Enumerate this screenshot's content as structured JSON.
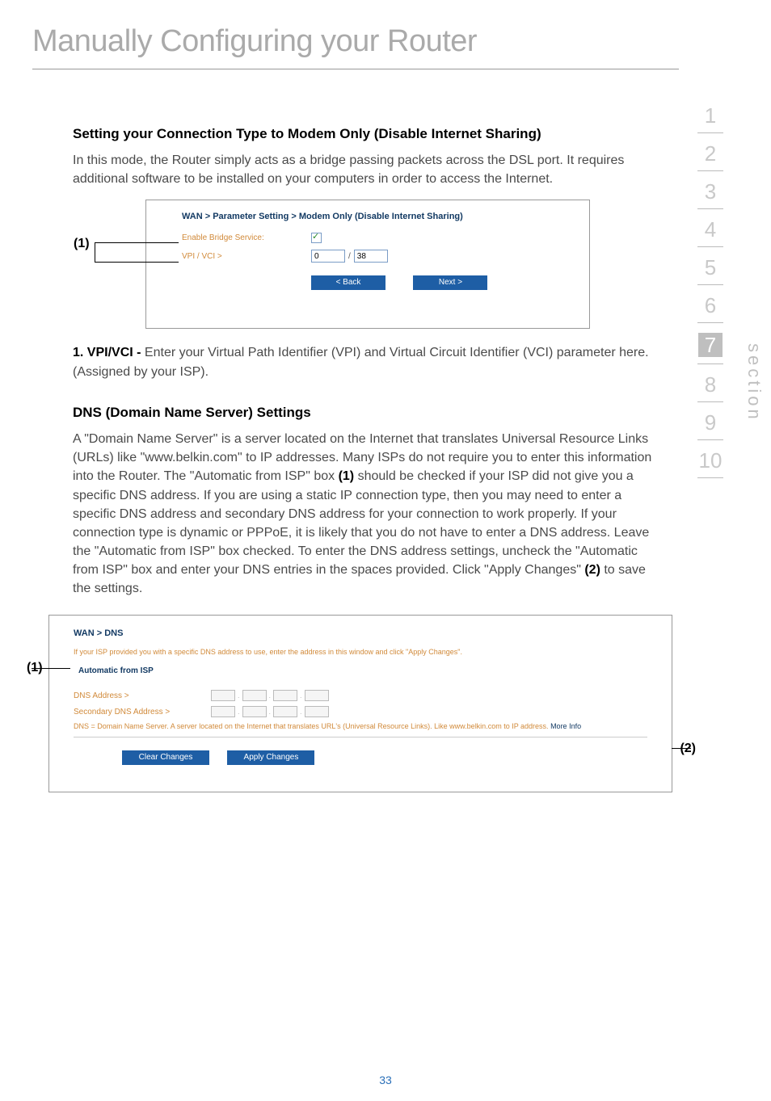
{
  "page_title": "Manually Configuring your Router",
  "heading1": "Setting your Connection Type to Modem Only (Disable Internet Sharing)",
  "para1": "In this mode, the Router simply acts as a bridge passing packets across the DSL port. It requires additional software to be installed on your computers in order to access the Internet.",
  "shot1": {
    "title": "WAN > Parameter Setting > Modem Only (Disable Internet Sharing)",
    "enable_label": "Enable Bridge Service:",
    "vpivci_label": "VPI / VCI >",
    "vpi_value": "0",
    "vci_value": "38",
    "back_btn": "< Back",
    "next_btn": "Next >",
    "callout": "(1)"
  },
  "item1_label": "1. VPI/VCI - ",
  "item1_text": "Enter your Virtual Path Identifier (VPI) and Virtual Circuit Identifier (VCI) parameter here. (Assigned by your ISP).",
  "heading2": "DNS (Domain Name Server) Settings",
  "para2a": "A \"Domain Name Server\" is a server located on the Internet that translates Universal Resource Links (URLs) like \"www.belkin.com\" to IP addresses. Many ISPs do not require you to enter this information into the Router. The \"Automatic from ISP\" box ",
  "para2b": "(1)",
  "para2c": " should be checked if your ISP did not give you a specific DNS address. If you are using a static IP connection type, then you may need to enter a specific DNS address and secondary DNS address for your connection to work properly. If your connection type is dynamic or PPPoE, it is likely that you do not have to enter a DNS address. Leave the \"Automatic from ISP\" box checked. To enter the DNS address settings, uncheck the \"Automatic from ISP\" box and enter your DNS entries in the spaces provided. Click \"Apply Changes\" ",
  "para2d": "(2)",
  "para2e": " to save the settings.",
  "shot2": {
    "title": "WAN > DNS",
    "desc": "If your ISP provided you with a specific DNS address to use, enter the address in this window and click \"Apply Changes\".",
    "auto_label": "Automatic from ISP",
    "dns_label": "DNS Address >",
    "sec_dns_label": "Secondary DNS Address >",
    "note1": "DNS = Domain Name Server. A server located on the Internet that translates URL's (Universal Resource Links). Like www.belkin.com to IP address. ",
    "more": "More Info",
    "clear_btn": "Clear Changes",
    "apply_btn": "Apply Changes",
    "callout_left": "(1)",
    "callout_right": "(2)"
  },
  "sidebar": [
    "1",
    "2",
    "3",
    "4",
    "5",
    "6",
    "7",
    "8",
    "9",
    "10"
  ],
  "sidebar_active_index": 6,
  "section_label": "section",
  "page_number": "33"
}
